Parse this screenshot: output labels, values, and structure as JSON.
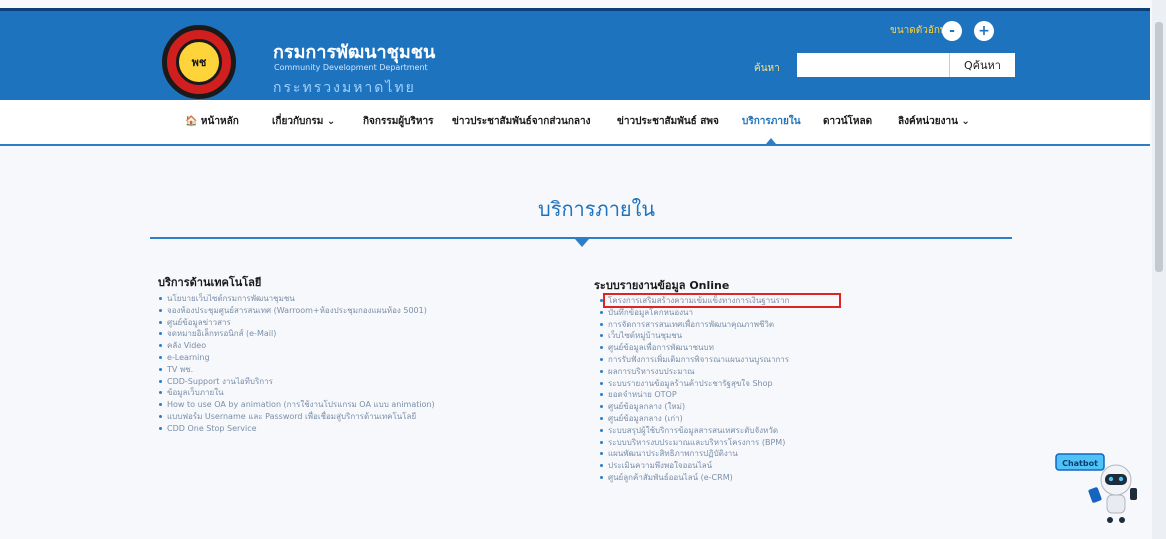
{
  "header": {
    "logo_text": "พช",
    "org_name_th": "กรมการพัฒนาชุมชน",
    "org_name_en": "Community Development Department",
    "ministry_th": "กระทรวงมหาดไทย",
    "text_size_label": "ขนาดตัวอักษร",
    "decrease_label": "-",
    "increase_label": "+",
    "search_label": "ค้นหา",
    "search_value": "",
    "search_button_label": "Qค้นหา"
  },
  "nav": {
    "items": [
      {
        "label": "🏠 หน้าหลัก"
      },
      {
        "label": "เกี่ยวกับกรม ⌄"
      },
      {
        "label": "กิจกรรมผู้บริหาร"
      },
      {
        "label": "ข่าวประชาสัมพันธ์จากส่วนกลาง"
      },
      {
        "label": "ข่าวประชาสัมพันธ์ สพจ"
      },
      {
        "label": "บริการภายใน"
      },
      {
        "label": "ดาวน์โหลด"
      },
      {
        "label": "ลิงค์หน่วยงาน ⌄"
      }
    ],
    "active_index": 5
  },
  "main": {
    "title": "บริการภายใน",
    "left_section": {
      "heading": "บริการด้านเทคโนโลยี",
      "items": [
        "นโยบายเว็บไซต์กรมการพัฒนาชุมชน",
        "จองห้องประชุมศูนย์สารสนเทศ (Warroom+ห้องประชุมกองแผนห้อง 5001)",
        "ศูนย์ข้อมูลข่าวสาร",
        "จดหมายอิเล็กทรอนิกส์ (e-Mail)",
        "คลัง Video",
        "e-Learning",
        "TV พช.",
        "CDD-Support งานไอทีบริการ",
        "ข้อมูลเว็บภายใน",
        "How to use OA by animation (การใช้งานโปรแกรม OA แบบ animation)",
        "แบบฟอร์ม Username และ Password เพื่อเชื่อมสู่บริการด้านเทคโนโลยี",
        "CDD One Stop Service"
      ]
    },
    "right_section": {
      "heading": "ระบบรายงานข้อมูล Online",
      "items": [
        "โครงการเสริมสร้างความเข้มแข็งทางการเงินฐานราก",
        "บันทึกข้อมูลโคกหนองนา",
        "การจัดการสารสนเทศเพื่อการพัฒนาคุณภาพชีวิต",
        "เว็บไซต์หมู่บ้านชุมชน",
        "ศูนย์ข้อมูลเพื่อการพัฒนาชนบท",
        "การรับฟังการเพิ่มเติมการพิจารณาแผนงานบูรณาการ",
        "ผลการบริหารงบประมาณ",
        "ระบบรายงานข้อมูลร้านค้าประชารัฐสุขใจ Shop",
        "ยอดจำหน่าย OTOP",
        "ศูนย์ข้อมูลกลาง (ใหม่)",
        "ศูนย์ข้อมูลกลาง (เก่า)",
        "ระบบสรุปผู้ใช้บริการข้อมูลสารสนเทศระดับจังหวัด",
        "ระบบบริหารงบประมาณและบริหารโครงการ (BPM)",
        "แผนพัฒนาประสิทธิภาพการปฏิบัติงาน",
        "ประเมินความพึงพอใจออนไลน์",
        "ศูนย์ลูกค้าสัมพันธ์ออนไลน์ (e-CRM)"
      ]
    }
  },
  "robot": {
    "badge_label": "Chatbot"
  },
  "colors": {
    "header_bg": "#1e73be",
    "accent": "#2d7dc7",
    "highlight_border": "#e02424"
  }
}
